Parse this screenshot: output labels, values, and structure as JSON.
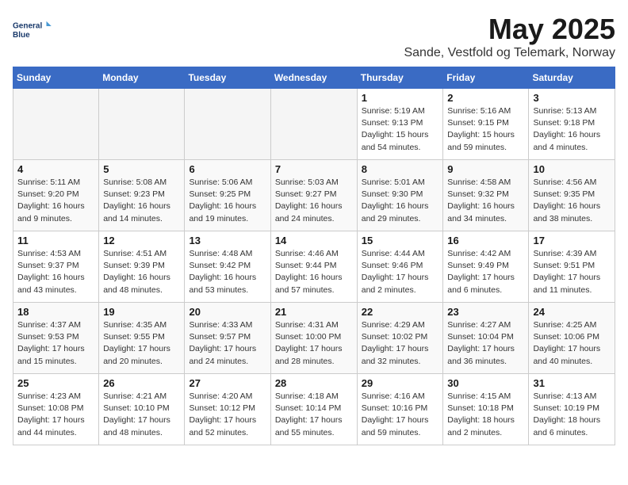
{
  "header": {
    "logo_line1": "General",
    "logo_line2": "Blue",
    "month_title": "May 2025",
    "location": "Sande, Vestfold og Telemark, Norway"
  },
  "weekdays": [
    "Sunday",
    "Monday",
    "Tuesday",
    "Wednesday",
    "Thursday",
    "Friday",
    "Saturday"
  ],
  "weeks": [
    [
      {
        "day": "",
        "info": ""
      },
      {
        "day": "",
        "info": ""
      },
      {
        "day": "",
        "info": ""
      },
      {
        "day": "",
        "info": ""
      },
      {
        "day": "1",
        "info": "Sunrise: 5:19 AM\nSunset: 9:13 PM\nDaylight: 15 hours\nand 54 minutes."
      },
      {
        "day": "2",
        "info": "Sunrise: 5:16 AM\nSunset: 9:15 PM\nDaylight: 15 hours\nand 59 minutes."
      },
      {
        "day": "3",
        "info": "Sunrise: 5:13 AM\nSunset: 9:18 PM\nDaylight: 16 hours\nand 4 minutes."
      }
    ],
    [
      {
        "day": "4",
        "info": "Sunrise: 5:11 AM\nSunset: 9:20 PM\nDaylight: 16 hours\nand 9 minutes."
      },
      {
        "day": "5",
        "info": "Sunrise: 5:08 AM\nSunset: 9:23 PM\nDaylight: 16 hours\nand 14 minutes."
      },
      {
        "day": "6",
        "info": "Sunrise: 5:06 AM\nSunset: 9:25 PM\nDaylight: 16 hours\nand 19 minutes."
      },
      {
        "day": "7",
        "info": "Sunrise: 5:03 AM\nSunset: 9:27 PM\nDaylight: 16 hours\nand 24 minutes."
      },
      {
        "day": "8",
        "info": "Sunrise: 5:01 AM\nSunset: 9:30 PM\nDaylight: 16 hours\nand 29 minutes."
      },
      {
        "day": "9",
        "info": "Sunrise: 4:58 AM\nSunset: 9:32 PM\nDaylight: 16 hours\nand 34 minutes."
      },
      {
        "day": "10",
        "info": "Sunrise: 4:56 AM\nSunset: 9:35 PM\nDaylight: 16 hours\nand 38 minutes."
      }
    ],
    [
      {
        "day": "11",
        "info": "Sunrise: 4:53 AM\nSunset: 9:37 PM\nDaylight: 16 hours\nand 43 minutes."
      },
      {
        "day": "12",
        "info": "Sunrise: 4:51 AM\nSunset: 9:39 PM\nDaylight: 16 hours\nand 48 minutes."
      },
      {
        "day": "13",
        "info": "Sunrise: 4:48 AM\nSunset: 9:42 PM\nDaylight: 16 hours\nand 53 minutes."
      },
      {
        "day": "14",
        "info": "Sunrise: 4:46 AM\nSunset: 9:44 PM\nDaylight: 16 hours\nand 57 minutes."
      },
      {
        "day": "15",
        "info": "Sunrise: 4:44 AM\nSunset: 9:46 PM\nDaylight: 17 hours\nand 2 minutes."
      },
      {
        "day": "16",
        "info": "Sunrise: 4:42 AM\nSunset: 9:49 PM\nDaylight: 17 hours\nand 6 minutes."
      },
      {
        "day": "17",
        "info": "Sunrise: 4:39 AM\nSunset: 9:51 PM\nDaylight: 17 hours\nand 11 minutes."
      }
    ],
    [
      {
        "day": "18",
        "info": "Sunrise: 4:37 AM\nSunset: 9:53 PM\nDaylight: 17 hours\nand 15 minutes."
      },
      {
        "day": "19",
        "info": "Sunrise: 4:35 AM\nSunset: 9:55 PM\nDaylight: 17 hours\nand 20 minutes."
      },
      {
        "day": "20",
        "info": "Sunrise: 4:33 AM\nSunset: 9:57 PM\nDaylight: 17 hours\nand 24 minutes."
      },
      {
        "day": "21",
        "info": "Sunrise: 4:31 AM\nSunset: 10:00 PM\nDaylight: 17 hours\nand 28 minutes."
      },
      {
        "day": "22",
        "info": "Sunrise: 4:29 AM\nSunset: 10:02 PM\nDaylight: 17 hours\nand 32 minutes."
      },
      {
        "day": "23",
        "info": "Sunrise: 4:27 AM\nSunset: 10:04 PM\nDaylight: 17 hours\nand 36 minutes."
      },
      {
        "day": "24",
        "info": "Sunrise: 4:25 AM\nSunset: 10:06 PM\nDaylight: 17 hours\nand 40 minutes."
      }
    ],
    [
      {
        "day": "25",
        "info": "Sunrise: 4:23 AM\nSunset: 10:08 PM\nDaylight: 17 hours\nand 44 minutes."
      },
      {
        "day": "26",
        "info": "Sunrise: 4:21 AM\nSunset: 10:10 PM\nDaylight: 17 hours\nand 48 minutes."
      },
      {
        "day": "27",
        "info": "Sunrise: 4:20 AM\nSunset: 10:12 PM\nDaylight: 17 hours\nand 52 minutes."
      },
      {
        "day": "28",
        "info": "Sunrise: 4:18 AM\nSunset: 10:14 PM\nDaylight: 17 hours\nand 55 minutes."
      },
      {
        "day": "29",
        "info": "Sunrise: 4:16 AM\nSunset: 10:16 PM\nDaylight: 17 hours\nand 59 minutes."
      },
      {
        "day": "30",
        "info": "Sunrise: 4:15 AM\nSunset: 10:18 PM\nDaylight: 18 hours\nand 2 minutes."
      },
      {
        "day": "31",
        "info": "Sunrise: 4:13 AM\nSunset: 10:19 PM\nDaylight: 18 hours\nand 6 minutes."
      }
    ]
  ]
}
